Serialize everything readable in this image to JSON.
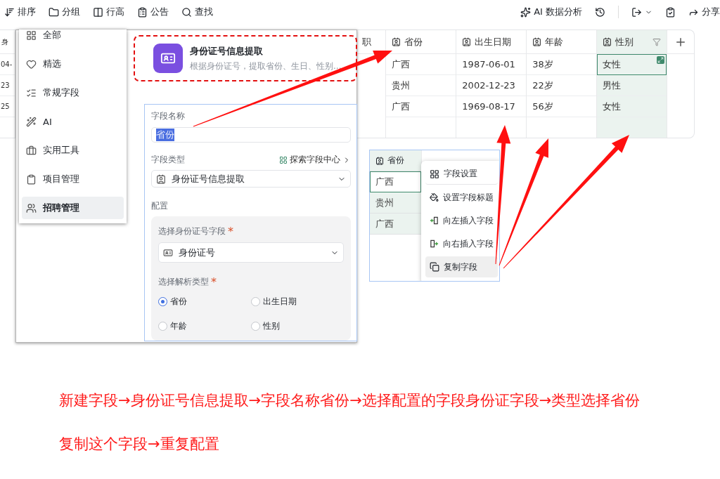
{
  "toolbar": {
    "left": [
      {
        "kind": "sort",
        "label": "排序"
      },
      {
        "kind": "group",
        "label": "分组"
      },
      {
        "kind": "height",
        "label": "行高"
      },
      {
        "kind": "notice",
        "label": "公告"
      },
      {
        "kind": "search",
        "label": "查找"
      }
    ],
    "right": [
      {
        "kind": "ai",
        "label": "AI 数据分析"
      },
      {
        "kind": "history"
      },
      {
        "kind": "export"
      },
      {
        "kind": "tasks"
      },
      {
        "kind": "share",
        "label": "分享"
      }
    ]
  },
  "table": {
    "first_column": {
      "header": "身",
      "cells": [
        "04-",
        "23",
        "25"
      ]
    },
    "partial_column": "职",
    "columns": [
      {
        "label": "省份",
        "selected": false,
        "filter": false
      },
      {
        "label": "出生日期",
        "selected": false,
        "filter": false
      },
      {
        "label": "年龄",
        "selected": false,
        "filter": false
      },
      {
        "label": "性别",
        "selected": true,
        "filter": true
      }
    ],
    "rows": [
      {
        "cells": [
          "广西",
          "1987-06-01",
          "38岁",
          "女性"
        ],
        "selected": true
      },
      {
        "cells": [
          "贵州",
          "2002-12-23",
          "22岁",
          "男性"
        ],
        "selected": false
      },
      {
        "cells": [
          "广西",
          "1969-08-17",
          "56岁",
          "女性"
        ],
        "selected": false
      }
    ]
  },
  "field_type_menu": {
    "items": [
      {
        "kind": "all",
        "label": "全部",
        "selected": false
      },
      {
        "kind": "featured",
        "label": "精选",
        "selected": false
      },
      {
        "kind": "basic",
        "label": "常规字段",
        "selected": false
      },
      {
        "kind": "ai",
        "label": "AI",
        "selected": false
      },
      {
        "kind": "tools",
        "label": "实用工具",
        "selected": false
      },
      {
        "kind": "project",
        "label": "项目管理",
        "selected": false
      },
      {
        "kind": "hiring",
        "label": "招聘管理",
        "selected": true
      }
    ]
  },
  "highlighted_option": {
    "title": "身份证号信息提取",
    "description": "根据身份证号，提取省份、生日、性别..."
  },
  "field_form": {
    "name_label": "字段名称",
    "name_value": "省份",
    "type_label": "字段类型",
    "explore_link": "探索字段中心",
    "type_value": "身份证号信息提取",
    "config_label": "配置",
    "id_field_label": "选择身份证号字段",
    "id_field_required_mark": "*",
    "id_field_value": "身份证号",
    "parse_label": "选择解析类型",
    "parse_required_mark": "*",
    "parse_options": [
      {
        "label": "省份",
        "selected": true
      },
      {
        "label": "出生日期",
        "selected": false
      },
      {
        "label": "年龄",
        "selected": false
      },
      {
        "label": "性别",
        "selected": false
      }
    ]
  },
  "small_table": {
    "header": "省份",
    "cells": [
      {
        "text": "广西",
        "selected": true
      },
      {
        "text": "贵州",
        "selected": false
      },
      {
        "text": "广西",
        "selected": false
      }
    ]
  },
  "context_menu": {
    "items": [
      {
        "kind": "settings",
        "label": "字段设置",
        "hovered": false
      },
      {
        "kind": "style",
        "label": "设置字段标题",
        "hovered": false
      },
      {
        "kind": "insert_left",
        "label": "向左插入字段",
        "hovered": false
      },
      {
        "kind": "insert_right",
        "label": "向右插入字段",
        "hovered": false
      },
      {
        "kind": "copy",
        "label": "复制字段",
        "hovered": true
      }
    ]
  },
  "caption": [
    "新建字段→身份证号信息提取→字段名称省份→选择配置的字段身份证字段→类型选择省份",
    "复制这个字段→重复配置"
  ]
}
